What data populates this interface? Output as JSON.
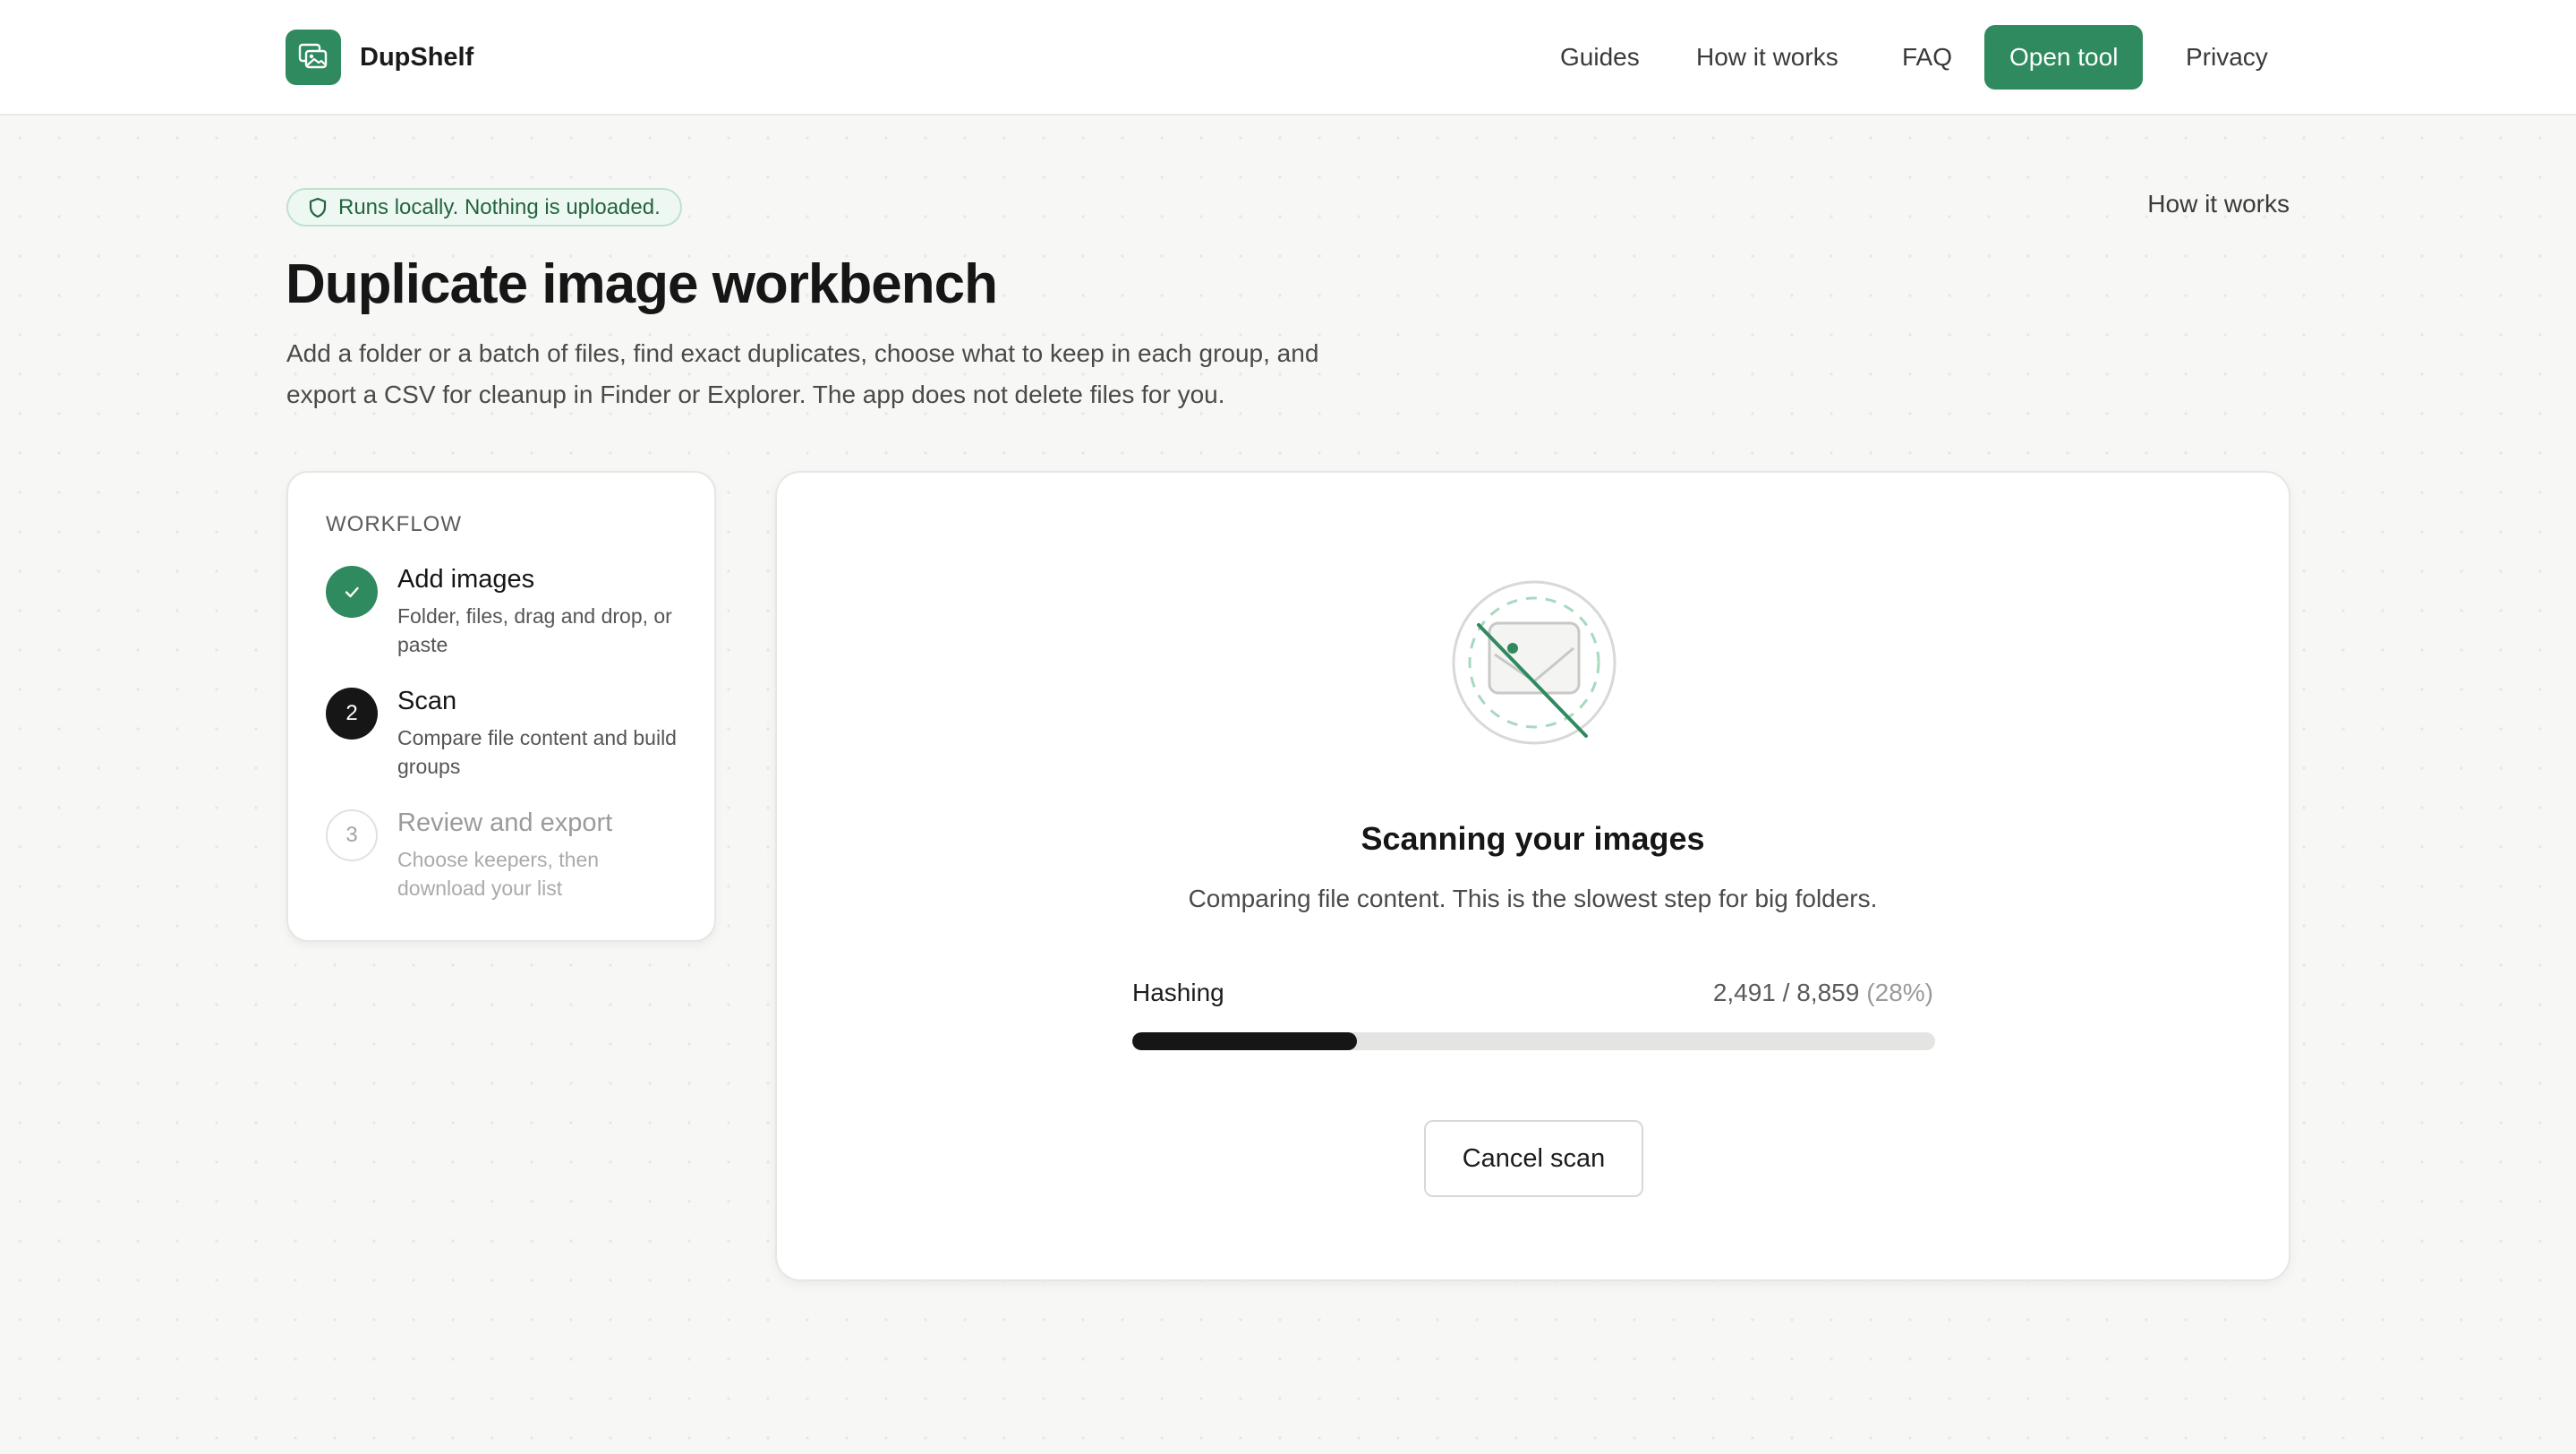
{
  "brand": {
    "name": "DupShelf",
    "logo_icon": "image-gallery-icon",
    "accent": "#2f8a5f"
  },
  "nav": {
    "guides": "Guides",
    "how_it_works": "How it works",
    "faq": "FAQ",
    "open_tool": "Open tool",
    "privacy": "Privacy"
  },
  "hero": {
    "badge": "Runs locally. Nothing is uploaded.",
    "badge_icon": "shield-icon",
    "top_link": "How it works",
    "title": "Duplicate image workbench",
    "lead": "Add a folder or a batch of files, find exact duplicates, choose what to keep in each group, and export a CSV for cleanup in Finder or Explorer. The app does not delete files for you."
  },
  "workflow": {
    "heading": "WORKFLOW",
    "steps": [
      {
        "status": "done",
        "icon": "check-icon",
        "title": "Add images",
        "description": "Folder, files, drag and drop, or paste"
      },
      {
        "status": "active",
        "number": "2",
        "title": "Scan",
        "description": "Compare file content and build groups"
      },
      {
        "status": "pending",
        "number": "3",
        "title": "Review and export",
        "description": "Choose keepers, then download your list"
      }
    ]
  },
  "scan": {
    "illustration": "image-scan-illustration",
    "title": "Scanning your images",
    "subtitle": "Comparing file content. This is the slowest step for big folders.",
    "phase": "Hashing",
    "count": "2,491 / 8,859",
    "percent_label": "(28%)",
    "progress": 0.28,
    "cancel_label": "Cancel scan"
  }
}
